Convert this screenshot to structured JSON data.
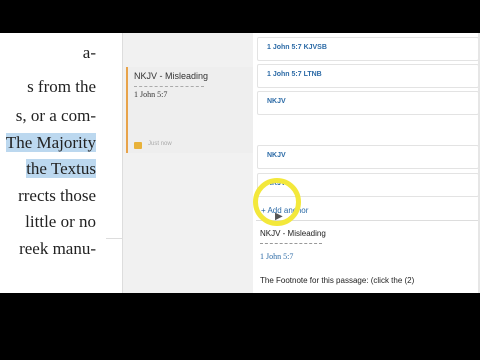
{
  "reader": {
    "lines": [
      "a-",
      "s from the",
      "s, or a com-",
      "The Majority",
      "the Textus",
      "rrects those",
      "little or no",
      "reek manu-"
    ]
  },
  "note_card": {
    "title": "NKJV - Misleading",
    "reference": "1 John 5:7",
    "faint_text": "Just now",
    "flag_color": "#e8b23a",
    "accent_color": "#e8a34a"
  },
  "anchors": [
    {
      "label": "1 John 5:7 KJVSB"
    },
    {
      "label": "1 John 5:7 LTNB"
    },
    {
      "label": "NKJV"
    },
    {
      "label": "NKJV"
    },
    {
      "label": "NKJV"
    }
  ],
  "add_anchor": "+ Add anchor",
  "detail": {
    "title": "NKJV - Misleading",
    "reference": "1 John 5:7",
    "footnote": "The Footnote for this passage: (click the (2)"
  },
  "colors": {
    "link": "#2b6aa6",
    "highlight": "#bcd8ef",
    "cursor_ring": "#f3e83b"
  }
}
